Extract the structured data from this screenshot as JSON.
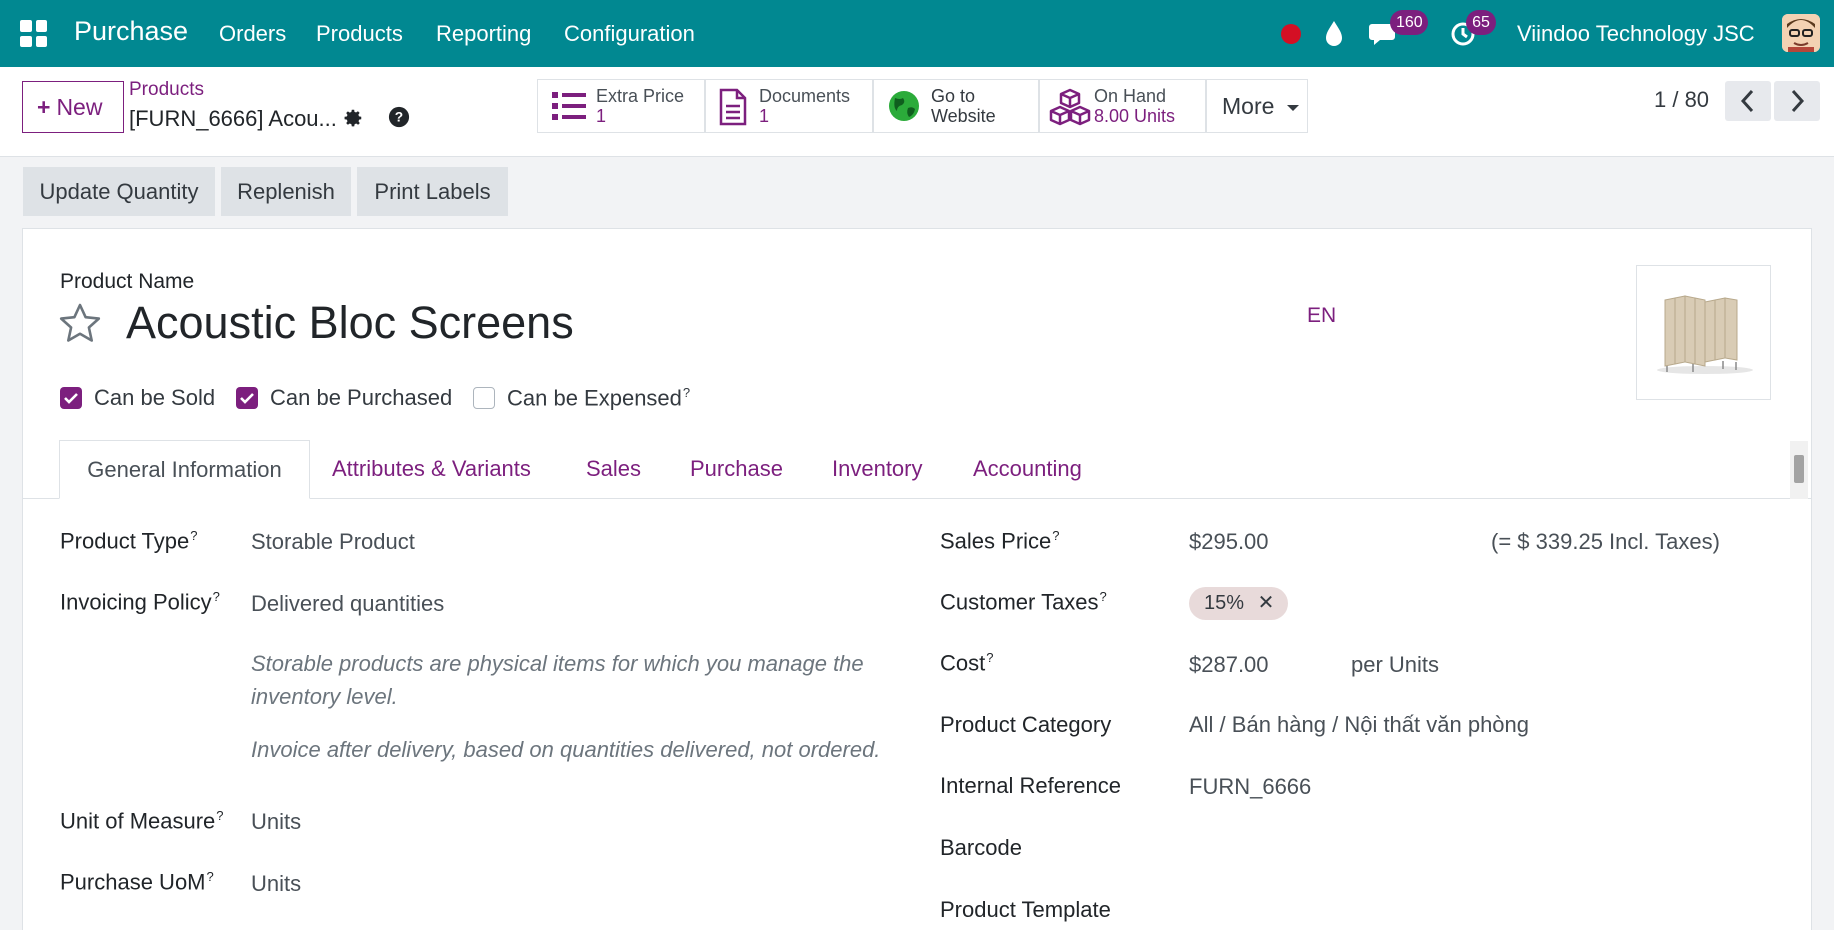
{
  "navbar": {
    "app_name": "Purchase",
    "menu": [
      "Orders",
      "Products",
      "Reporting",
      "Configuration"
    ],
    "chat_count": "160",
    "activity_count": "65",
    "company": "Viindoo Technology JSC"
  },
  "control_panel": {
    "new_label": "New",
    "breadcrumb_parent": "Products",
    "breadcrumb_current": "[FURN_6666] Acou...",
    "smart_buttons": [
      {
        "label": "Extra Price",
        "value": "1",
        "icon": "list-icon"
      },
      {
        "label": "Documents",
        "value": "1",
        "icon": "document-icon"
      },
      {
        "label": "Go to",
        "value": "Website",
        "icon": "globe-icon"
      },
      {
        "label": "On Hand",
        "value": "8.00 Units",
        "icon": "cubes-icon"
      }
    ],
    "more_label": "More",
    "pager": "1 / 80"
  },
  "actions": [
    "Update Quantity",
    "Replenish",
    "Print Labels"
  ],
  "form": {
    "product_name_label": "Product Name",
    "product_name": "Acoustic Bloc Screens",
    "lang": "EN",
    "checkboxes": [
      {
        "label": "Can be Sold",
        "checked": true
      },
      {
        "label": "Can be Purchased",
        "checked": true
      },
      {
        "label": "Can be Expensed",
        "checked": false
      }
    ],
    "tabs": [
      "General Information",
      "Attributes & Variants",
      "Sales",
      "Purchase",
      "Inventory",
      "Accounting"
    ],
    "left": {
      "product_type_label": "Product Type",
      "product_type": "Storable Product",
      "invoicing_policy_label": "Invoicing Policy",
      "invoicing_policy": "Delivered quantities",
      "help_1": "Storable products are physical items for which you manage the inventory level.",
      "help_2": "Invoice after delivery, based on quantities delivered, not ordered.",
      "uom_label": "Unit of Measure",
      "uom": "Units",
      "purchase_uom_label": "Purchase UoM",
      "purchase_uom": "Units"
    },
    "right": {
      "sales_price_label": "Sales Price",
      "sales_price": "$295.00",
      "incl_taxes": "(= $ 339.25 Incl. Taxes)",
      "customer_taxes_label": "Customer Taxes",
      "tax_tag": "15%",
      "cost_label": "Cost",
      "cost": "$287.00",
      "cost_unit": "per Units",
      "category_label": "Product Category",
      "category": "All / Bán hàng / Nội thất văn phòng",
      "internal_ref_label": "Internal Reference",
      "internal_ref": "FURN_6666",
      "barcode_label": "Barcode",
      "template_label": "Product Template"
    }
  }
}
